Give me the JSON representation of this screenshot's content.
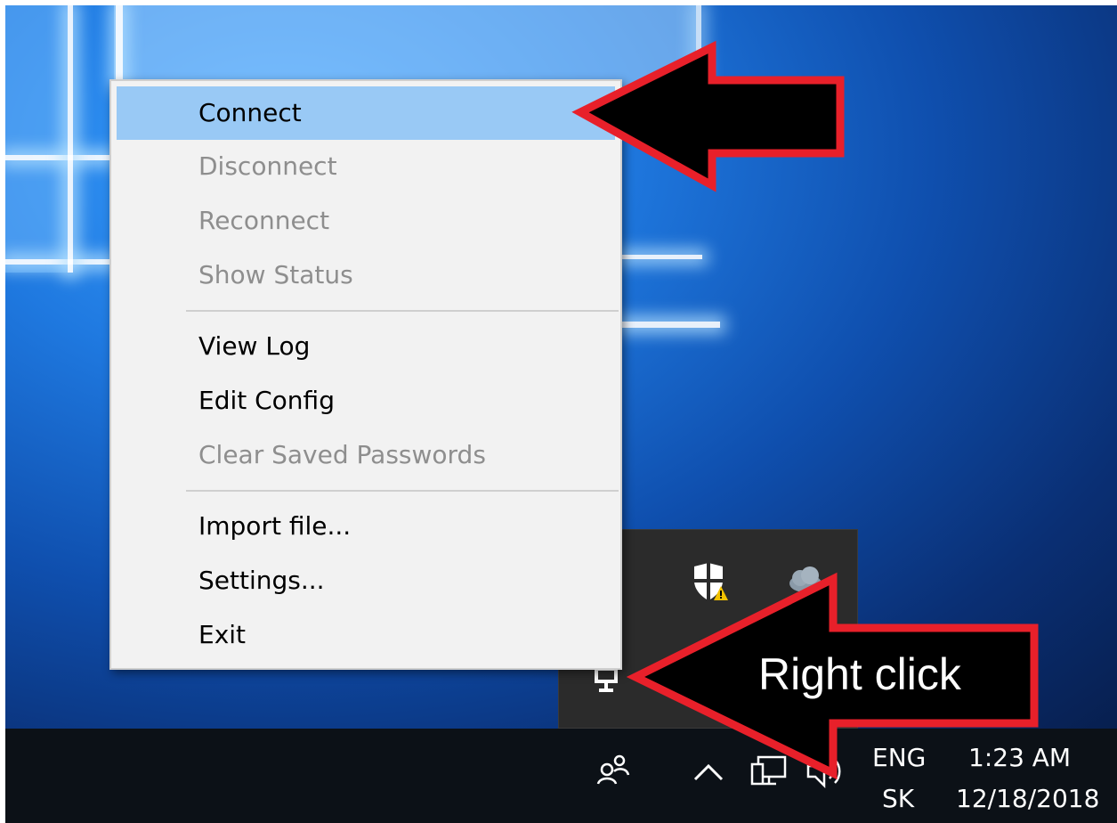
{
  "context_menu": {
    "items": [
      {
        "label": "Connect",
        "state": "highlighted"
      },
      {
        "label": "Disconnect",
        "state": "disabled"
      },
      {
        "label": "Reconnect",
        "state": "disabled"
      },
      {
        "label": "Show Status",
        "state": "disabled"
      },
      {
        "label": "View Log",
        "state": "enabled"
      },
      {
        "label": "Edit Config",
        "state": "enabled"
      },
      {
        "label": "Clear Saved Passwords",
        "state": "disabled"
      },
      {
        "label": "Import file...",
        "state": "enabled"
      },
      {
        "label": "Settings...",
        "state": "enabled"
      },
      {
        "label": "Exit",
        "state": "enabled"
      }
    ]
  },
  "annotation": {
    "label": "Right click",
    "arrow_fill": "#000000",
    "arrow_outline": "#e8202a"
  },
  "tray_flyout": {
    "icons": [
      "security-shield-warning-icon",
      "cloud-sync-icon",
      "vpn-tray-icon"
    ]
  },
  "taskbar": {
    "icons": [
      "people-icon",
      "chevron-up-icon",
      "network-icon",
      "volume-icon"
    ],
    "language_top": "ENG",
    "language_bottom": "SK",
    "time": "1:23 AM",
    "date": "12/18/2018"
  },
  "colors": {
    "menu_background": "#f2f2f2",
    "menu_highlight": "#99c9f5",
    "disabled_text": "#8e8e8e",
    "taskbar": "#0c1117"
  }
}
